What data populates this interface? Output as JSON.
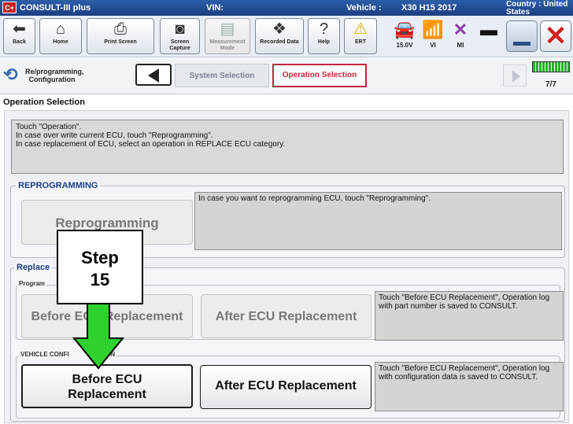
{
  "titlebar": {
    "app": "CONSULT-III plus",
    "vin_label": "VIN:",
    "vehicle_label": "Vehicle :",
    "vehicle_value": "X30 H15 2017",
    "country": "Country : United States",
    "logo_text": "C+"
  },
  "toolbar": {
    "back": "Back",
    "home": "Home",
    "print_screen": "Print Screen",
    "screen_capture": "Screen Capture",
    "measurement_mode": "Measurement Mode",
    "recorded_data": "Recorded Data",
    "help": "Help",
    "ert": "ERT",
    "voltage": "15.0V",
    "vi": "VI",
    "mi": "MI"
  },
  "breadcrumb": {
    "reprog": "Re/programming, Configuration",
    "system_selection": "System Selection",
    "operation_selection": "Operation Selection",
    "page_count": "7/7"
  },
  "page_title": "Operation Selection",
  "instructions": [
    "Touch \"Operation\".",
    "In case over write current ECU, touch \"Reprogramming\".",
    "In case replacement of ECU, select an operation in REPLACE ECU category."
  ],
  "reprogramming": {
    "title": "REPROGRAMMING",
    "button": "Reprogramming",
    "description": "In case you want to reprogramming ECU, touch \"Reprogramming\"."
  },
  "replace": {
    "title": "Replace",
    "programming_sub": "Program",
    "before_label": "Before ECU Replacement",
    "after_label": "After ECU Replacement",
    "description": "Touch \"Before ECU Replacement\", Operation log with part number is saved to CONSULT."
  },
  "vehicle_config": {
    "title": "VEHICLE CONFI",
    "title_tail": "ATION",
    "before_line1": "Before ECU",
    "before_line2": "Replacement",
    "after_label": "After ECU Replacement",
    "description": "Touch \"Before ECU Replacement\", Operation log with configuration data is saved to CONSULT."
  },
  "callout": {
    "line1": "Step",
    "line2": "15",
    "arrow_color": "#2fd12f"
  }
}
